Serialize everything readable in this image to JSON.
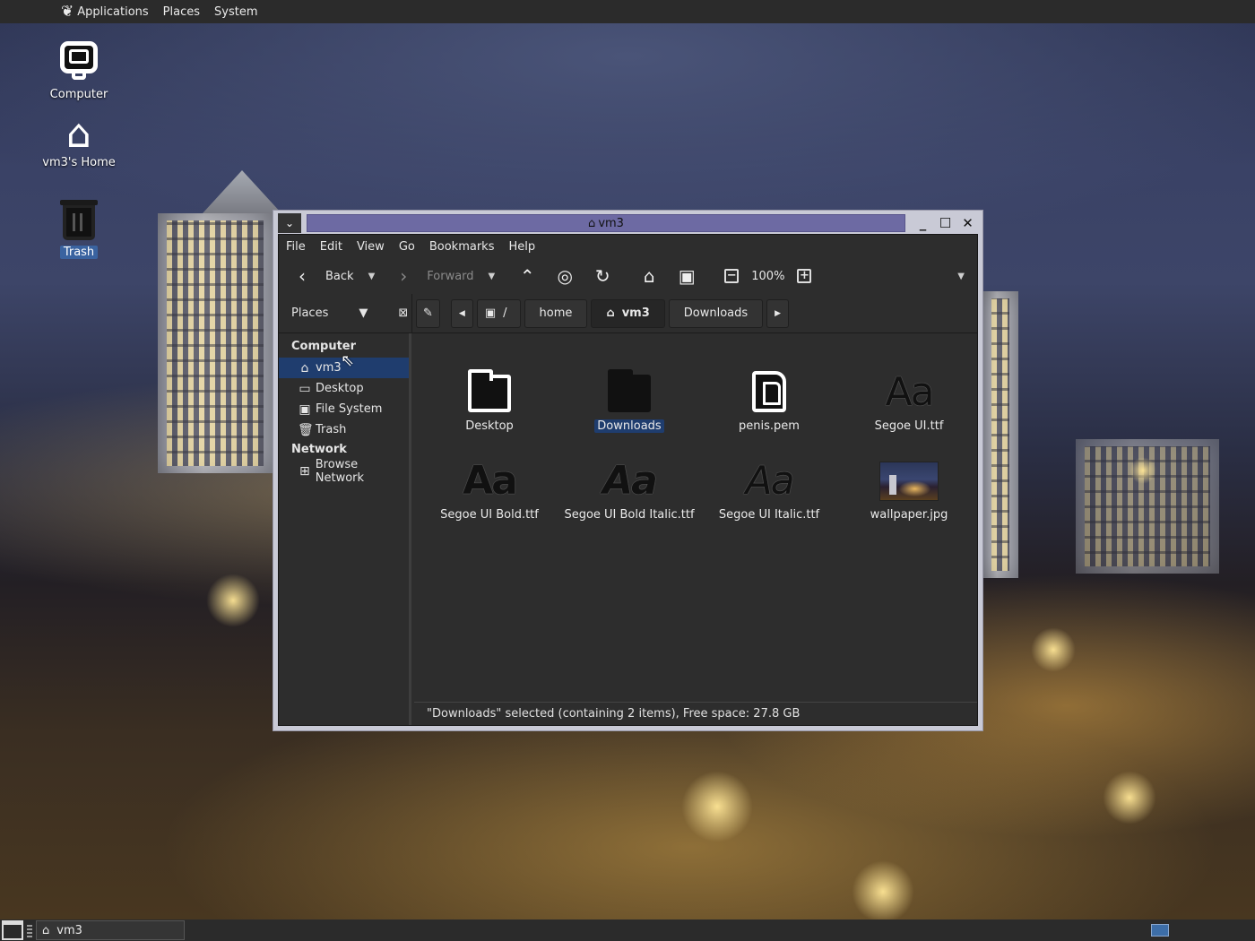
{
  "top_panel": {
    "menus": [
      "Applications",
      "Places",
      "System"
    ]
  },
  "desktop": {
    "icons": [
      {
        "label": "Computer",
        "icon": "computer-icon"
      },
      {
        "label": "vm3's Home",
        "icon": "home-icon"
      },
      {
        "label": "Trash",
        "icon": "trash-icon",
        "selected": true
      }
    ]
  },
  "window": {
    "title": "vm3",
    "menubar": [
      "File",
      "Edit",
      "View",
      "Go",
      "Bookmarks",
      "Help"
    ],
    "toolbar": {
      "back": "Back",
      "forward": "Forward",
      "zoom": "100%"
    },
    "location": {
      "places_label": "Places",
      "path_root": "/",
      "path": [
        "home",
        "vm3",
        "Downloads"
      ],
      "active": "vm3"
    },
    "sidebar": {
      "computer_heading": "Computer",
      "computer_items": [
        "vm3",
        "Desktop",
        "File System",
        "Trash"
      ],
      "network_heading": "Network",
      "network_items": [
        "Browse Network"
      ],
      "selected": "vm3"
    },
    "files": [
      {
        "name": "Desktop",
        "type": "folder"
      },
      {
        "name": "Downloads",
        "type": "folder",
        "selected": true
      },
      {
        "name": "penis.pem",
        "type": "document"
      },
      {
        "name": "Segoe UI.ttf",
        "type": "font"
      },
      {
        "name": "Segoe UI Bold.ttf",
        "type": "font-bold"
      },
      {
        "name": "Segoe UI Bold Italic.ttf",
        "type": "font-bold-italic"
      },
      {
        "name": "Segoe UI Italic.ttf",
        "type": "font-italic"
      },
      {
        "name": "wallpaper.jpg",
        "type": "image"
      }
    ],
    "status": "\"Downloads\" selected (containing 2 items), Free space: 27.8 GB"
  },
  "bottom_panel": {
    "task": "vm3"
  },
  "colors": {
    "selection": "#1f3d6e",
    "titlebar": "#6d6aa3",
    "panel": "#2b2b2b"
  }
}
